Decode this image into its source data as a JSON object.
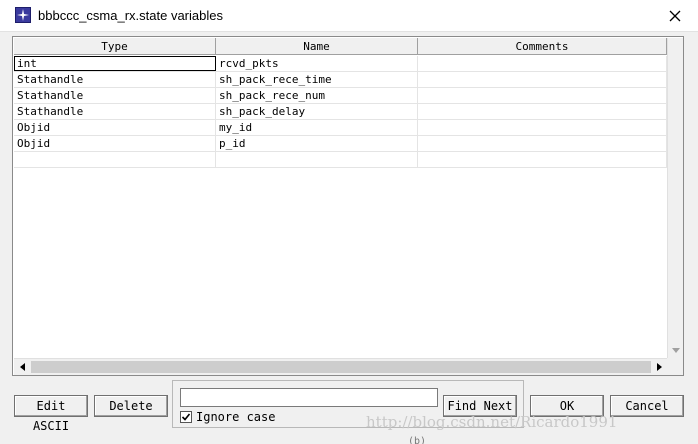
{
  "window": {
    "title": "bbbccc_csma_rx.state variables",
    "app_icon": "opnet-star-icon",
    "close_icon": "close-icon"
  },
  "grid": {
    "columns": [
      "Type",
      "Name",
      "Comments"
    ],
    "rows": [
      {
        "type": "int",
        "name": "rcvd_pkts",
        "comments": ""
      },
      {
        "type": "Stathandle",
        "name": "sh_pack_rece_time",
        "comments": ""
      },
      {
        "type": "Stathandle",
        "name": "sh_pack_rece_num",
        "comments": ""
      },
      {
        "type": "Stathandle",
        "name": "sh_pack_delay",
        "comments": ""
      },
      {
        "type": "Objid",
        "name": "my_id",
        "comments": ""
      },
      {
        "type": "Objid",
        "name": "p_id",
        "comments": ""
      },
      {
        "type": "",
        "name": "",
        "comments": ""
      }
    ],
    "editing_cell": "rows.0.type"
  },
  "buttons": {
    "edit_ascii": "Edit ASCII",
    "delete": "Delete",
    "find_next": "Find Next",
    "ok": "OK",
    "cancel": "Cancel"
  },
  "find": {
    "value": "",
    "ignore_case_label": "Ignore case",
    "ignore_case_checked": true
  },
  "watermark": "http://blog.csdn.net/Ricardo1991",
  "caption_fragment": "(b)"
}
